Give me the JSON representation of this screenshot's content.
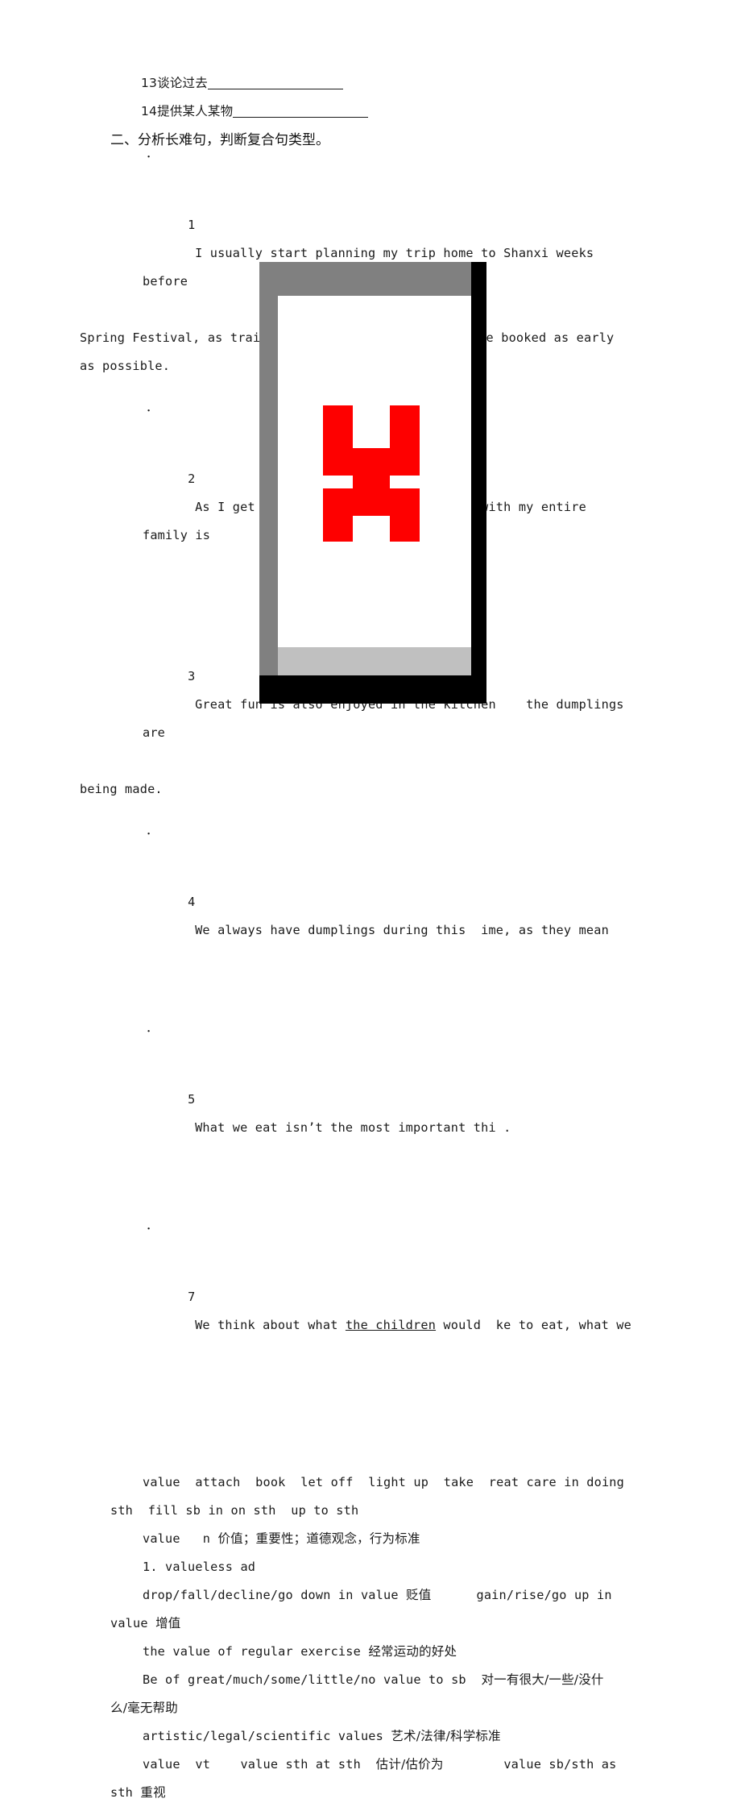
{
  "document": {
    "type": "study-notes-worksheet",
    "language": "zh-CN + en"
  },
  "top_items": [
    {
      "number": "13",
      "label": "谈论过去",
      "blank_width": 168
    },
    {
      "number": "14",
      "label": "提供某人某物",
      "blank_width": 168
    }
  ],
  "section_heading": "二、分析长难句，判断复合句类型。",
  "sentences": [
    {
      "dot": "．",
      "number": "1",
      "lines": [
        "I usually start planning my trip home to Shanxi weeks before",
        "Spring Festival, as train tickets or flights have to be booked as early",
        "as possible."
      ]
    },
    {
      "dot": "．",
      "number": "2",
      "lines": [
        "As I get older, coming home and being with my entire family is"
      ]
    },
    {
      "dot": "",
      "number": "3",
      "lines": [
        "Great fun is also enjoyed in the kitchen    the dumplings are",
        "being made."
      ]
    },
    {
      "dot": "．",
      "number": "4",
      "lines": [
        "We always have dumplings during this  ime, as they mean"
      ]
    },
    {
      "dot": "．",
      "number": "5",
      "lines": [
        "What we eat isn’t the most important thi ."
      ]
    },
    {
      "dot": "．",
      "number": "7",
      "lines": [
        "We think about what the children would  ke to eat, what we"
      ]
    }
  ],
  "vocab_block": {
    "line1": "value  attach  book  let off  light up  take  reat care in doing",
    "line2": "sth  fill sb in on sth  up to sth"
  },
  "entries": [
    {
      "id": "value-n",
      "head": "value   n ",
      "gloss": "价值；重要性；道德观念，行为标准"
    },
    {
      "id": "valueless",
      "head": "1. valueless ad"
    },
    {
      "id": "drop-gain",
      "left_en": "drop/fall/decline/go down in value ",
      "left_cn": "贬值",
      "right_en": "gain/rise/go up in",
      "wrap_en": "value ",
      "wrap_cn": "增值"
    },
    {
      "id": "regular-exercise",
      "en": "the value of regular exercise ",
      "cn": "经常运动的好处"
    },
    {
      "id": "be-of-value",
      "en": "Be of great/much/some/little/no value to sb  ",
      "cn": "对一有很大/一些/没什",
      "cn_wrap": "么/毫无帮助"
    },
    {
      "id": "artistic-values",
      "en": "artistic/legal/scientific values ",
      "cn": "艺术/法律/科学标准"
    },
    {
      "id": "value-vt",
      "head": "value  vt    value sth at sth  ",
      "cn1": "估计/估价为",
      "right_en": "value sb/sth as",
      "wrap_en": "sth ",
      "wrap_cn": "重视"
    }
  ],
  "overlay": {
    "name": "redacting-window-graphic",
    "colors": {
      "black": "#000000",
      "dark_gray": "#808080",
      "light_gray": "#c0c0c0",
      "white": "#ffffff",
      "red": "#fe0000"
    },
    "red_figure": "h-shaped-person-glyph"
  }
}
